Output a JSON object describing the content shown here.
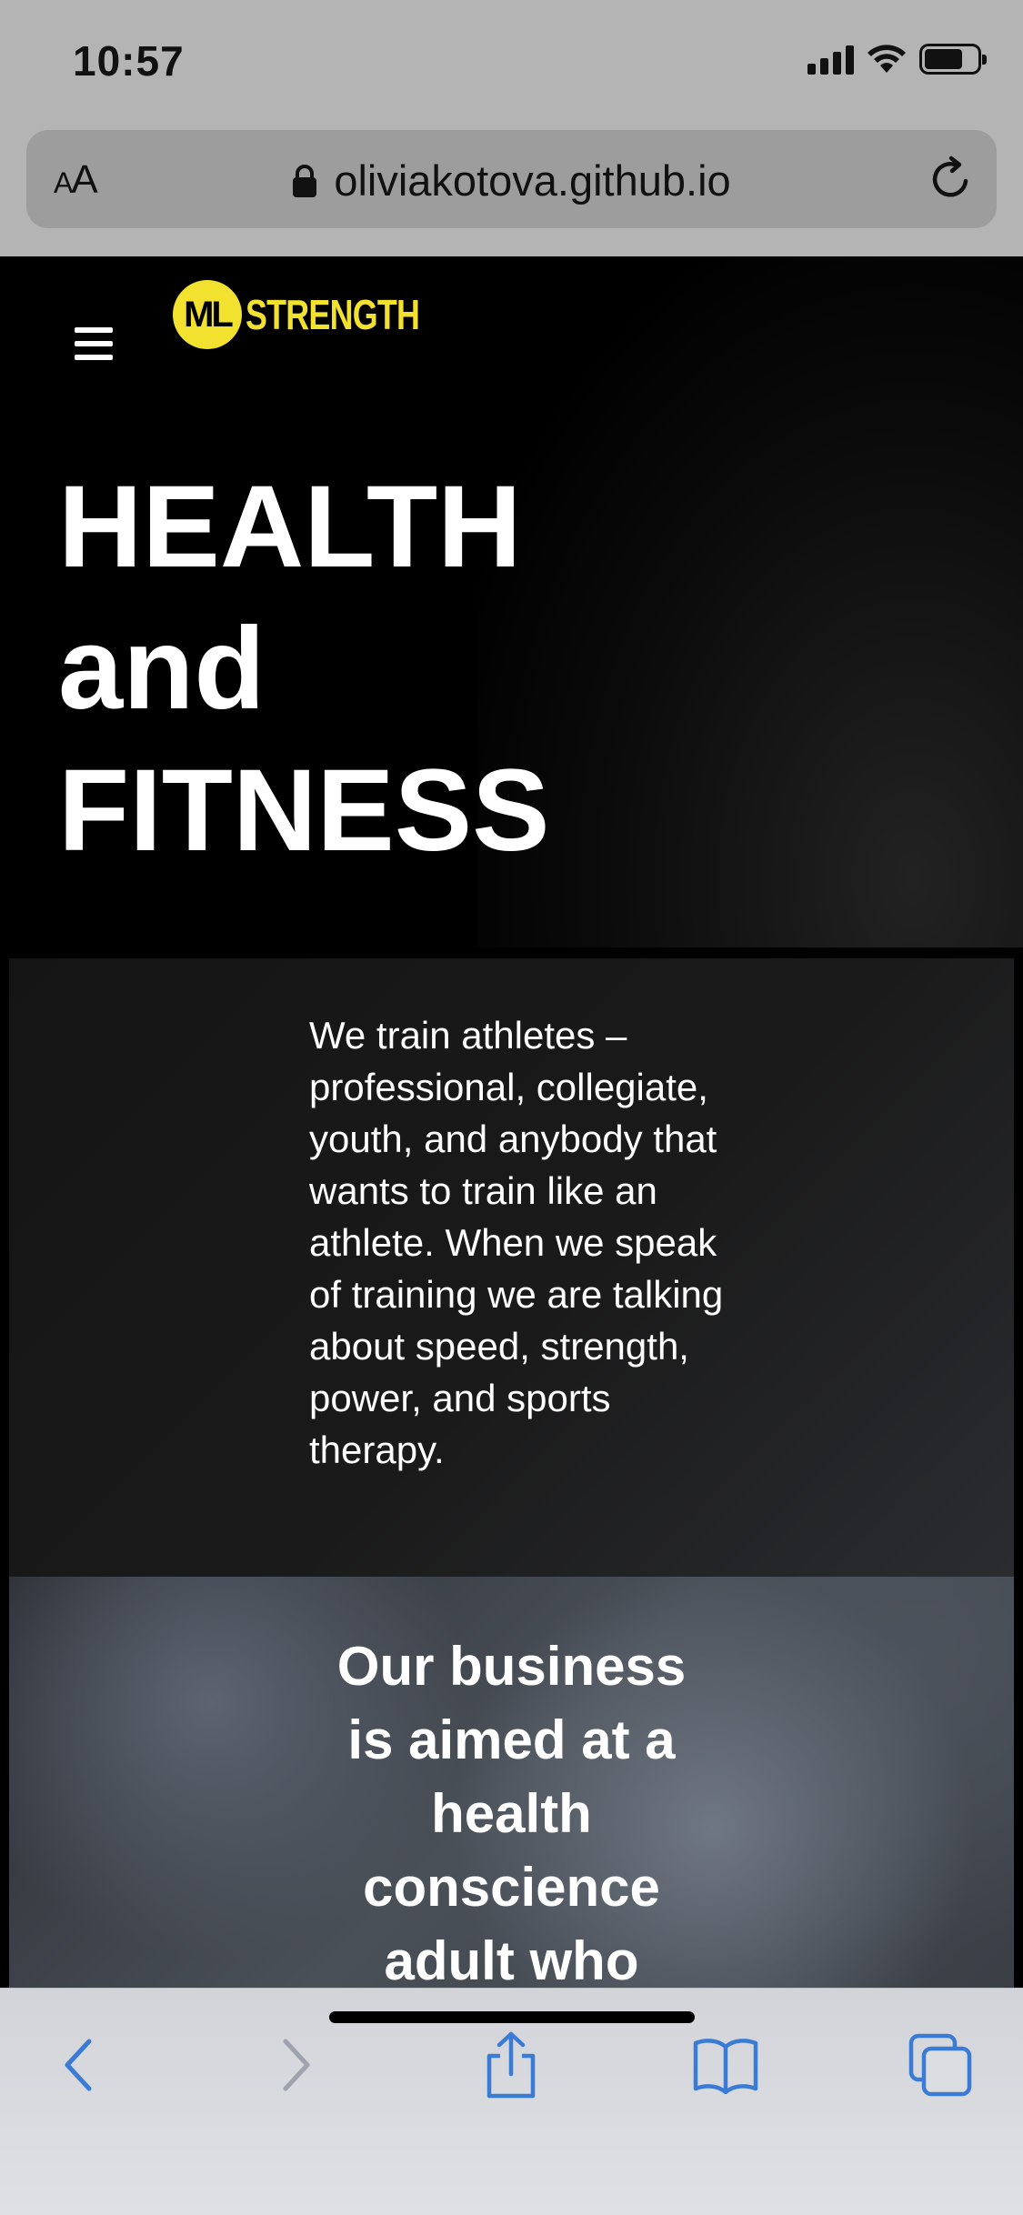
{
  "status_bar": {
    "time": "10:57"
  },
  "browser": {
    "text_size_button": {
      "small": "A",
      "large": "A"
    },
    "url": "oliviakotova.github.io"
  },
  "site": {
    "logo": {
      "badge": "ML",
      "text": "STRENGTH",
      "color": "#f3e12f"
    },
    "hero_title": [
      "HEALTH",
      "and",
      "FITNESS"
    ],
    "intro_text": "We train athletes – professional, collegiate, youth, and anybody that wants to train like an athlete. When we speak of training we are talking about speed, strength, power, and sports therapy.",
    "business_text": [
      "Our business",
      "is aimed at a",
      "health",
      "conscience",
      "adult who"
    ]
  },
  "toolbar": {
    "accent": "#3a7bd5",
    "buttons": [
      "back-icon",
      "forward-icon",
      "share-icon",
      "bookmarks-icon",
      "tabs-icon"
    ]
  }
}
